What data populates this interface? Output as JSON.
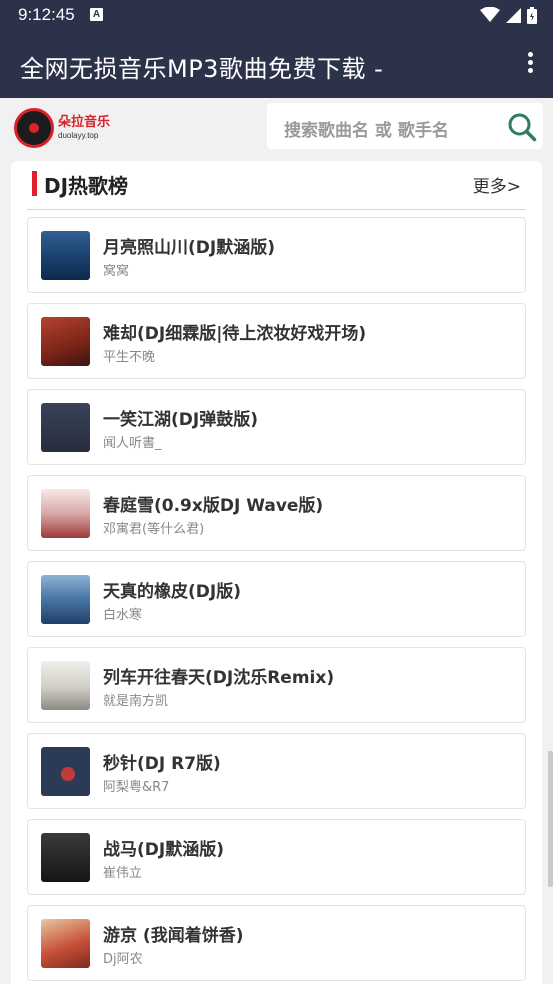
{
  "status_bar": {
    "time": "9:12:45",
    "notif_letter": "A"
  },
  "app_bar": {
    "title": "全网无损音乐MP3歌曲免费下载 -"
  },
  "logo": {
    "text": "朵拉音乐",
    "subtext": "duolayy.top"
  },
  "search": {
    "placeholder": "搜索歌曲名 或 歌手名"
  },
  "section": {
    "title": "DJ热歌榜",
    "more": "更多>"
  },
  "songs": [
    {
      "title": "月亮照山川(DJ默涵版)",
      "artist": "窝窝",
      "cover_color": "#1f4f7e"
    },
    {
      "title": "难却(DJ细霖版|待上浓妆好戏开场)",
      "artist": "平生不晚",
      "cover_color": "#8a2a1e"
    },
    {
      "title": "一笑江湖(DJ弹鼓版)",
      "artist": "闻人听書_",
      "cover_color": "#30384a"
    },
    {
      "title": "春庭雪(0.9x版DJ Wave版)",
      "artist": "邓寓君(等什么君)",
      "cover_color": "#e9d6d2"
    },
    {
      "title": "天真的橡皮(DJ版)",
      "artist": "白水寒",
      "cover_color": "#3f6c99"
    },
    {
      "title": "列车开往春天(DJ沈乐Remix)",
      "artist": "就是南方凯",
      "cover_color": "#d8d8d4"
    },
    {
      "title": "秒针(DJ R7版)",
      "artist": "阿梨粤&R7",
      "cover_color": "#27374f"
    },
    {
      "title": "战马(DJ默涵版)",
      "artist": "崔伟立",
      "cover_color": "#1d1d1d"
    },
    {
      "title": "游京 (我闻着饼香)",
      "artist": "Dj阿农",
      "cover_color": "#c8513a"
    }
  ]
}
